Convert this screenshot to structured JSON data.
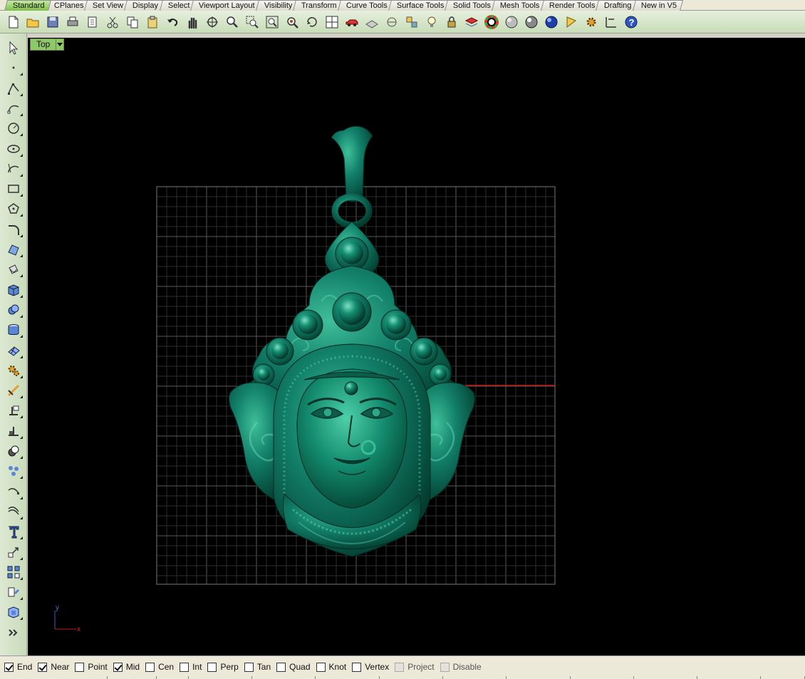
{
  "tabs": [
    "Standard",
    "CPlanes",
    "Set View",
    "Display",
    "Select",
    "Viewport Layout",
    "Visibility",
    "Transform",
    "Curve Tools",
    "Surface Tools",
    "Solid Tools",
    "Mesh Tools",
    "Render Tools",
    "Drafting",
    "New in V5"
  ],
  "active_tab": "Standard",
  "viewport": {
    "label": "Top"
  },
  "axes": {
    "x": "x",
    "y": "y"
  },
  "osnaps": [
    {
      "label": "End",
      "checked": true
    },
    {
      "label": "Near",
      "checked": true
    },
    {
      "label": "Point",
      "checked": false
    },
    {
      "label": "Mid",
      "checked": true
    },
    {
      "label": "Cen",
      "checked": false
    },
    {
      "label": "Int",
      "checked": false
    },
    {
      "label": "Perp",
      "checked": false
    },
    {
      "label": "Tan",
      "checked": false
    },
    {
      "label": "Quad",
      "checked": false
    },
    {
      "label": "Knot",
      "checked": false
    },
    {
      "label": "Vertex",
      "checked": false
    },
    {
      "label": "Project",
      "checked": false,
      "disabled": true
    },
    {
      "label": "Disable",
      "checked": false,
      "disabled": true
    }
  ],
  "toolbar_icons": [
    "new-file-icon",
    "open-folder-icon",
    "save-icon",
    "print-icon",
    "import-icon",
    "cut-icon",
    "copy-icon",
    "paste-icon",
    "undo-icon",
    "pan-hand-icon",
    "rotate-view-icon",
    "zoom-dynamic-icon",
    "zoom-window-icon",
    "zoom-extents-icon",
    "zoom-selected-icon",
    "rotate-camera-icon",
    "four-viewports-icon",
    "car-icon",
    "construction-plane-icon",
    "grid-snap-icon",
    "properties-icon",
    "light-bulb-icon",
    "lock-icon",
    "layer-icon",
    "color-wheel-icon",
    "shaded-sphere-icon",
    "rendered-sphere-icon",
    "blue-sphere-icon",
    "render-icon",
    "gear-tools-icon",
    "dimension-icon",
    "help-icon"
  ],
  "left_icons": [
    "select-arrow-icon",
    "point-icon",
    "polyline-icon",
    "curve-control-icon",
    "circle-icon",
    "ellipse-icon",
    "arc-icon",
    "rectangle-icon",
    "polygon-icon",
    "fillet-curve-icon",
    "surface-corner-icon",
    "extrude-icon",
    "box-solid-icon",
    "boolean-union-icon",
    "cylinder-icon",
    "mesh-plane-icon",
    "gear-explode-icon",
    "trim-icon",
    "split-icon",
    "join-icon",
    "boolean-icon",
    "points-cluster-icon",
    "curve-edit-icon",
    "offset-curve-icon",
    "text-icon",
    "scale-icon",
    "array-icon",
    "group-icon",
    "block-icon",
    "more-chevron-icon"
  ]
}
